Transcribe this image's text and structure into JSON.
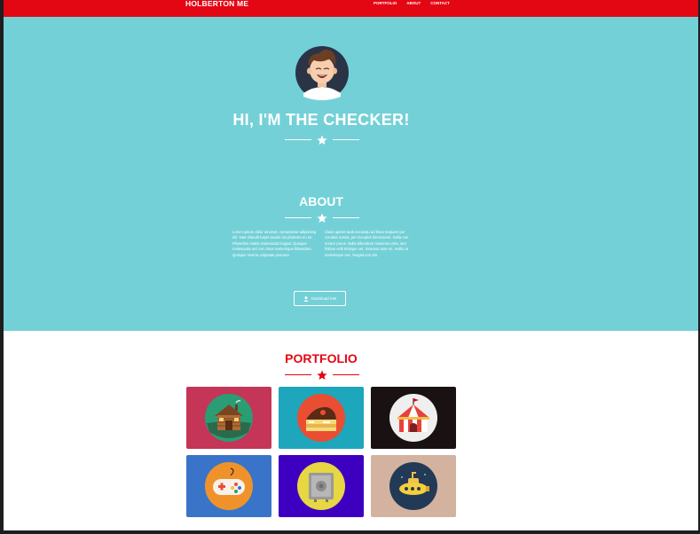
{
  "navbar": {
    "brand": "HOLBERTON ME",
    "links": [
      "PORTFOLIO",
      "ABOUT",
      "CONTACT"
    ]
  },
  "hero": {
    "title": "HI, I'M THE CHECKER!"
  },
  "about": {
    "title": "ABOUT",
    "col1": "Lorem ipsum dolor sit amet, consectetur adipiscing elit. Nam blandit turpis iaculis dui pharetra eu tor. Phasellus mattis malesuada feugiat. Quisque malesuada orci non risus scelerisque bibendum. Quisque viverra vulputate posuere.",
    "col2": "Class aptent taciti sociosqu ad litora torquent per conubia nostra, per inceptos himenaeos. Nulla non ornare purus. Nulla bibendum maximus urna, sed finibus velit tristique vel. Vivamus ante mi, mollis at scelerisque nec, feugiat non dui.",
    "download_label": "Download me!"
  },
  "portfolio": {
    "title": "PORTFOLIO",
    "items": [
      {
        "icon": "cabin-icon",
        "bg": "#c43558"
      },
      {
        "icon": "cake-icon",
        "bg": "#1ea6bd"
      },
      {
        "icon": "circus-tent-icon",
        "bg": "#1a1212"
      },
      {
        "icon": "game-controller-icon",
        "bg": "#3a74c9"
      },
      {
        "icon": "safe-icon",
        "bg": "#3d00c0"
      },
      {
        "icon": "submarine-icon",
        "bg": "#d3b3a0"
      }
    ]
  },
  "colors": {
    "navbar": "#e30613",
    "hero": "#73d0d7",
    "accent": "#e30613",
    "white": "#ffffff"
  }
}
